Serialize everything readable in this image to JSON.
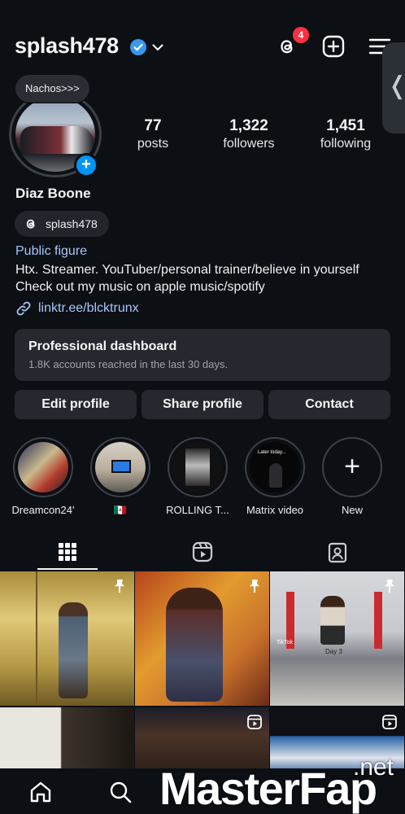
{
  "header": {
    "username": "splash478",
    "notification_count": "4"
  },
  "profile": {
    "note": "Nachos>>>",
    "full_name": "Diaz Boone",
    "threads_handle": "splash478",
    "category": "Public figure",
    "bio_line1": "Htx. Streamer. YouTuber/personal trainer/believe in yourself",
    "bio_line2": "Check out my music on apple music/spotify",
    "link": "linktr.ee/blcktrunx"
  },
  "stats": {
    "posts_count": "77",
    "posts_label": "posts",
    "followers_count": "1,322",
    "followers_label": "followers",
    "following_count": "1,451",
    "following_label": "following"
  },
  "dashboard": {
    "title": "Professional dashboard",
    "subtitle": "1.8K accounts reached in the last 30 days."
  },
  "actions": {
    "edit": "Edit profile",
    "share": "Share profile",
    "contact": "Contact"
  },
  "highlights": [
    {
      "label": "Dreamcon24'"
    },
    {
      "label": "🇲🇽"
    },
    {
      "label": "ROLLING T..."
    },
    {
      "label": "Matrix video"
    },
    {
      "label": "New"
    }
  ],
  "grid_captions": {
    "day": "Day 3",
    "tiktok": "TikTok",
    "later_today": "Later today..."
  },
  "watermark": {
    "part1": "Master",
    "part2": "Fap",
    "suffix": ".net"
  },
  "colors": {
    "background": "#0c0f14",
    "surface": "#25282e",
    "link": "#a8c7fa",
    "verified": "#3897f0",
    "badge": "#ff3040",
    "add_story": "#0095f6"
  },
  "icons": [
    "verified-badge-icon",
    "chevron-down-icon",
    "threads-icon",
    "create-plus-icon",
    "menu-icon",
    "link-icon",
    "grid-icon",
    "reels-icon",
    "tagged-icon",
    "pin-icon",
    "home-icon",
    "search-icon"
  ]
}
